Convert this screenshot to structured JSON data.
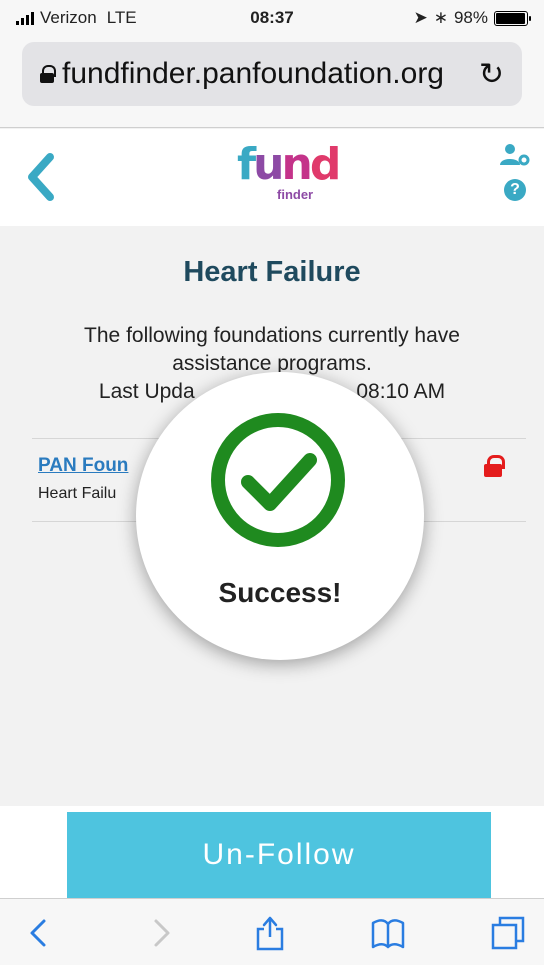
{
  "status_bar": {
    "carrier": "Verizon",
    "network": "LTE",
    "time": "08:37",
    "battery": "98%",
    "battery_level": 0.98
  },
  "browser": {
    "url": "fundfinder.panfoundation.org"
  },
  "header": {
    "logo_text_fund": [
      "f",
      "u",
      "n",
      "d"
    ],
    "logo_text_finder": "finder",
    "colors": {
      "teal": "#3aa9c4",
      "purple": "#8d4aa5",
      "pink": "#c4338a"
    }
  },
  "main": {
    "title": "Heart Failure",
    "intro_line1": "The following foundations currently have",
    "intro_line2": "assistance programs.",
    "intro_line3_left": "Last Upda",
    "intro_line3_right": "08:10 AM",
    "list": [
      {
        "title": "PAN Foun",
        "subtitle": "Heart Failu"
      }
    ]
  },
  "overlay": {
    "message": "Success!",
    "check_color": "#1f8a1f"
  },
  "action": {
    "unfollow_label": "Un-Follow",
    "color": "#4ec4df"
  }
}
